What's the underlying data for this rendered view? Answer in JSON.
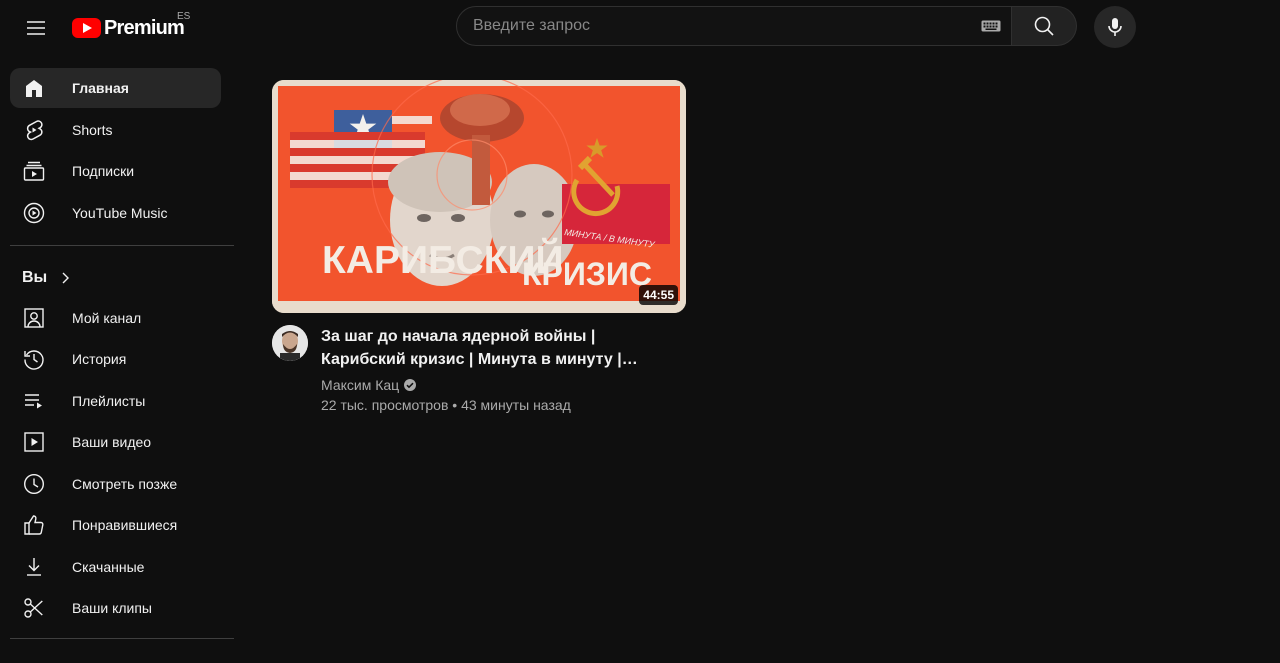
{
  "header": {
    "logo_text": "Premium",
    "country_code": "ES",
    "search_placeholder": "Введите запрос"
  },
  "sidebar": {
    "main_items": [
      {
        "label": "Главная",
        "icon": "home-icon",
        "active": true
      },
      {
        "label": "Shorts",
        "icon": "shorts-icon"
      },
      {
        "label": "Подписки",
        "icon": "subscriptions-icon"
      },
      {
        "label": "YouTube Music",
        "icon": "youtube-music-icon"
      }
    ],
    "you_section_title": "Вы",
    "you_items": [
      {
        "label": "Мой канал",
        "icon": "your-channel-icon"
      },
      {
        "label": "История",
        "icon": "history-icon"
      },
      {
        "label": "Плейлисты",
        "icon": "playlists-icon"
      },
      {
        "label": "Ваши видео",
        "icon": "your-videos-icon"
      },
      {
        "label": "Смотреть позже",
        "icon": "watch-later-icon"
      },
      {
        "label": "Понравившиеся",
        "icon": "liked-icon"
      },
      {
        "label": "Скачанные",
        "icon": "downloads-icon"
      },
      {
        "label": "Ваши клипы",
        "icon": "clips-icon"
      }
    ]
  },
  "video": {
    "thumbnail_text_1": "КАРИБСКИЙ",
    "thumbnail_text_2": "КРИЗИС",
    "thumbnail_stamp": "МИНУТА / В МИНУТУ",
    "duration": "44:55",
    "title": "За шаг до начала ядерной войны | Карибский кризис | Минута в минуту | Максим Кац",
    "channel": "Максим Кац",
    "stats": "22 тыс. просмотров • 43 минуты назад"
  },
  "colors": {
    "background": "#0f0f0f",
    "accent_red": "#ff0000",
    "active_item": "#272727",
    "thumbnail_orange": "#f2542d"
  }
}
